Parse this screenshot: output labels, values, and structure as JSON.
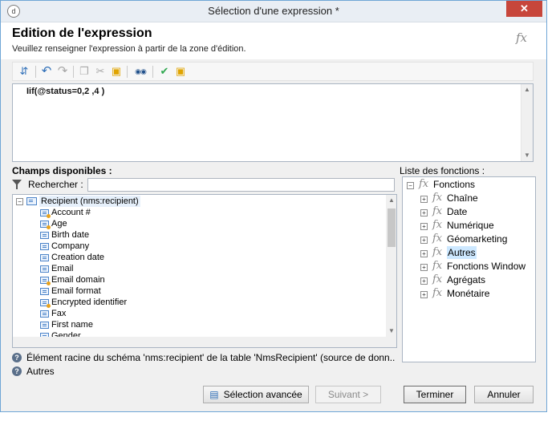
{
  "window": {
    "title": "Sélection d'une expression *",
    "close_glyph": "✕",
    "app_icon": "d"
  },
  "header": {
    "title": "Edition de l'expression",
    "subtitle": "Veuillez renseigner l'expression à partir de la zone d'édition.",
    "fx_label": "fx"
  },
  "toolbar": {
    "buttons": [
      {
        "name": "insert-field-button",
        "icon": "insert-icon",
        "glyph": "⇵"
      },
      {
        "name": "undo-button",
        "icon": "undo-icon",
        "glyph": "↶"
      },
      {
        "name": "redo-button",
        "icon": "redo-icon",
        "glyph": "↷"
      },
      {
        "name": "copy-button",
        "icon": "copy-icon",
        "glyph": "❐"
      },
      {
        "name": "cut-button",
        "icon": "scissors-icon",
        "glyph": "✂"
      },
      {
        "name": "paste-button",
        "icon": "clipboard-icon",
        "glyph": "▣"
      },
      {
        "name": "find-button",
        "icon": "binoculars-icon",
        "glyph": "◉◉"
      },
      {
        "name": "validate-button",
        "icon": "check-icon",
        "glyph": "✔"
      },
      {
        "name": "paste-special-button",
        "icon": "clipboard-icon",
        "glyph": "▣"
      }
    ]
  },
  "editor": {
    "expression": "Iif(@status=0,2 ,4  )"
  },
  "fields_panel": {
    "label": "Champs disponibles :",
    "search_label": "Rechercher :",
    "search_value": "",
    "root": "Recipient (nms:recipient)",
    "items": [
      {
        "label": "Account #",
        "key": true
      },
      {
        "label": "Age",
        "key": true
      },
      {
        "label": "Birth date",
        "key": false
      },
      {
        "label": "Company",
        "key": false
      },
      {
        "label": "Creation date",
        "key": false
      },
      {
        "label": "Email",
        "key": false
      },
      {
        "label": "Email domain",
        "key": true
      },
      {
        "label": "Email format",
        "key": false
      },
      {
        "label": "Encrypted identifier",
        "key": true
      },
      {
        "label": "Fax",
        "key": false
      },
      {
        "label": "First name",
        "key": false
      },
      {
        "label": "Gender",
        "key": false
      }
    ]
  },
  "functions_panel": {
    "label": "Liste des fonctions :",
    "root": "Fonctions",
    "items": [
      "Chaîne",
      "Date",
      "Numérique",
      "Géomarketing",
      "Autres",
      "Fonctions Window",
      "Agrégats",
      "Monétaire"
    ]
  },
  "help": {
    "line1": "Élément racine du schéma 'nms:recipient' de la table 'NmsRecipient' (source de donn...",
    "line2": "Autres"
  },
  "buttons": {
    "advanced": "Sélection avancée",
    "next": "Suivant >",
    "finish": "Terminer",
    "cancel": "Annuler"
  },
  "colors": {
    "accent": "#6fa6d6",
    "close": "#c7463b",
    "selection": "#cde8ff"
  }
}
